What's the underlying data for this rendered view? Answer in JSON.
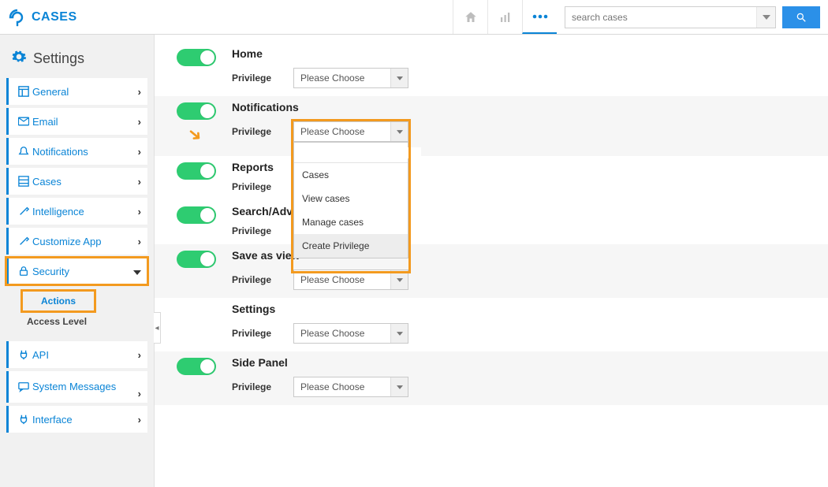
{
  "brand": "CASES",
  "search": {
    "placeholder": "search cases"
  },
  "sidebar": {
    "heading": "Settings",
    "items": [
      {
        "label": "General",
        "icon": "layout"
      },
      {
        "label": "Email",
        "icon": "mail"
      },
      {
        "label": "Notifications",
        "icon": "bell"
      },
      {
        "label": "Cases",
        "icon": "grid"
      },
      {
        "label": "Intelligence",
        "icon": "tools"
      },
      {
        "label": "Customize App",
        "icon": "tools"
      },
      {
        "label": "Security",
        "icon": "lock",
        "expanded": true
      },
      {
        "label": "API",
        "icon": "plug"
      },
      {
        "label": "System Messages",
        "icon": "message"
      },
      {
        "label": "Interface",
        "icon": "plug"
      }
    ],
    "security_sub": {
      "actions": "Actions",
      "access": "Access Level"
    }
  },
  "sections": [
    {
      "title": "Home",
      "select": "Please Choose"
    },
    {
      "title": "Notifications",
      "select": "Please Choose",
      "open": true
    },
    {
      "title": "Reports",
      "select": ""
    },
    {
      "title": "Search/Advanced search",
      "select": ""
    },
    {
      "title": "Save as view",
      "select": "Please Choose"
    },
    {
      "title": "Settings",
      "select": "Please Choose"
    },
    {
      "title": "Side Panel",
      "select": "Please Choose"
    }
  ],
  "priv_label": "Privilege",
  "dd_options": [
    "Cases",
    "View cases",
    "Manage cases",
    "Create Privilege"
  ]
}
